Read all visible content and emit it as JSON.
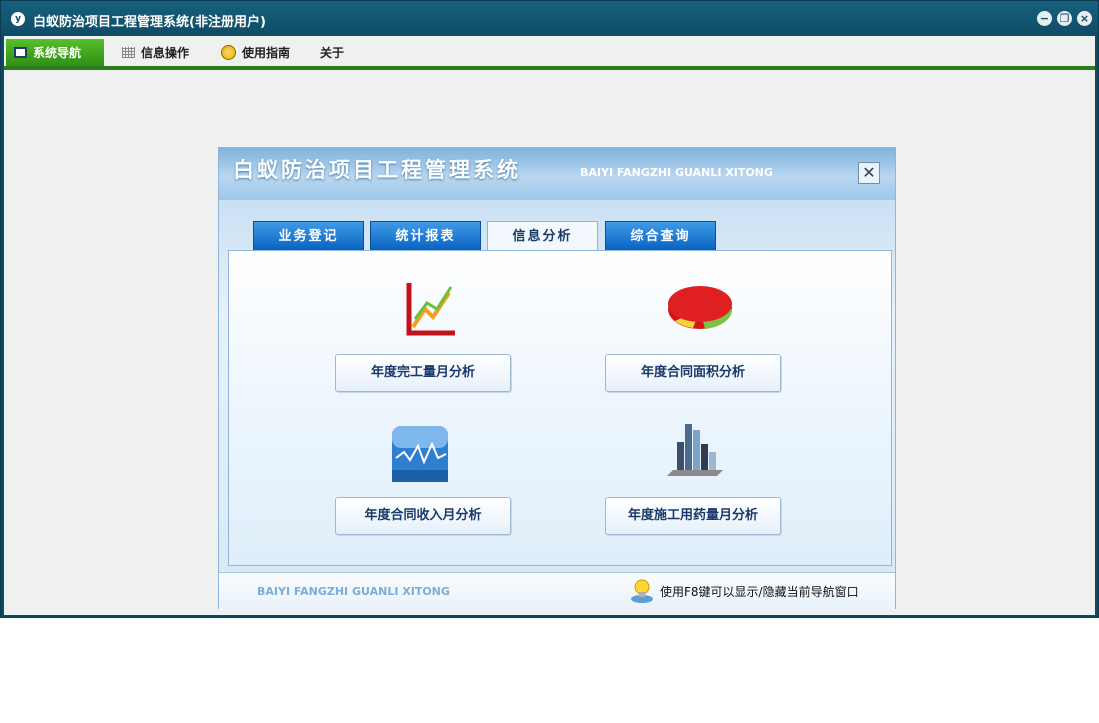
{
  "window": {
    "title": "白蚁防治项目工程管理系统(非注册用户)"
  },
  "menubar": {
    "items": [
      {
        "label": "系统导航",
        "icon": "monitor-icon"
      },
      {
        "label": "信息操作",
        "icon": "grid-icon"
      },
      {
        "label": "使用指南",
        "icon": "help-icon"
      },
      {
        "label": "关于",
        "icon": ""
      }
    ]
  },
  "panel": {
    "title": "白蚁防治项目工程管理系统",
    "subtitle": "BAIYI FANGZHI GUANLI XITONG",
    "close_label": "✕",
    "tabs": [
      "业务登记",
      "统计报表",
      "信息分析",
      "综合查询"
    ],
    "active_tab": "信息分析",
    "buttons": [
      {
        "label": "年度完工量月分析",
        "icon": "line-chart-icon"
      },
      {
        "label": "年度合同面积分析",
        "icon": "pie-chart-icon"
      },
      {
        "label": "年度合同收入月分析",
        "icon": "wave-chart-icon"
      },
      {
        "label": "年度施工用药量月分析",
        "icon": "bar-chart-icon"
      }
    ],
    "footer": {
      "subtitle": "BAIYI FANGZHI GUANLI XITONG",
      "tip": "使用F8键可以显示/隐藏当前导航窗口"
    }
  },
  "colors": {
    "accent": "#2e7d1c",
    "title_bar": "#0e4c66",
    "tab_blue": "#0a62c0"
  }
}
